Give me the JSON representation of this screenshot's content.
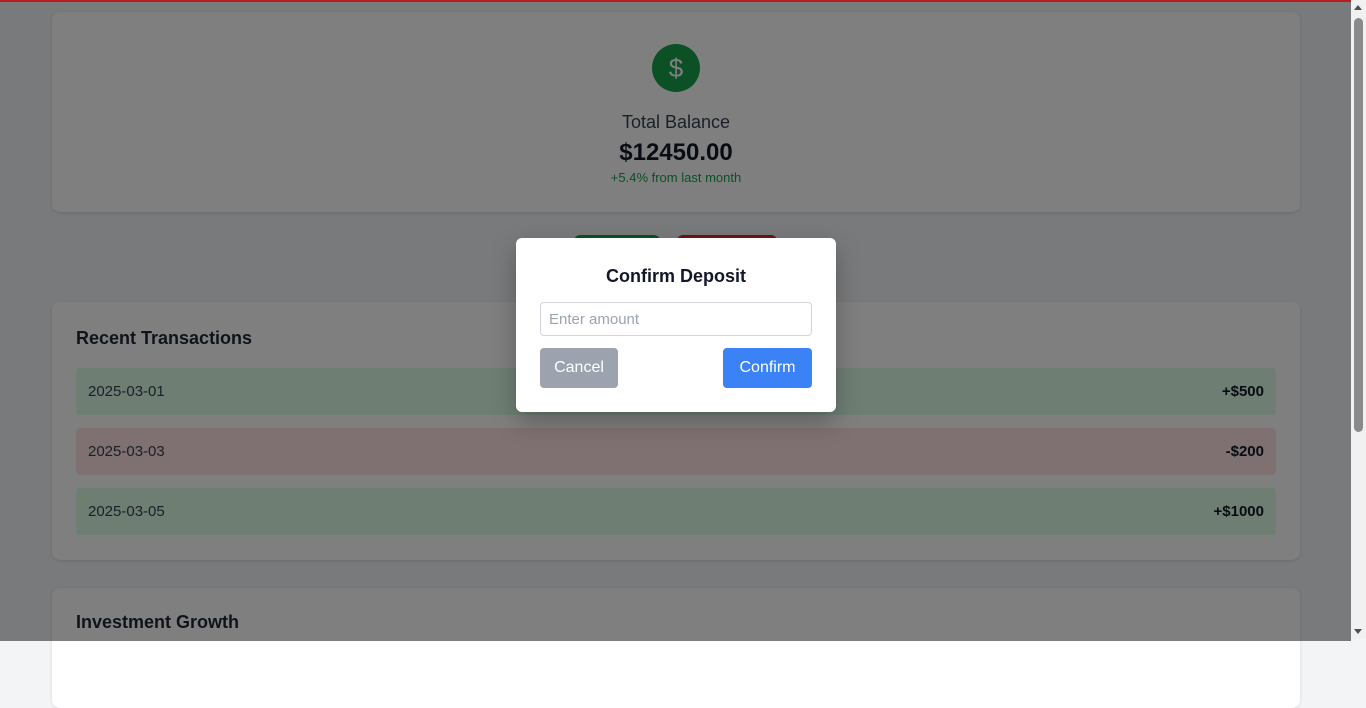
{
  "balance": {
    "icon": "dollar-sign-icon",
    "icon_glyph": "$",
    "label": "Total Balance",
    "amount": "$12450.00",
    "change": "+5.4% from last month"
  },
  "transactions": {
    "title": "Recent Transactions",
    "rows": [
      {
        "date": "2025-03-01",
        "amount": "+$500",
        "type": "credit"
      },
      {
        "date": "2025-03-03",
        "amount": "-$200",
        "type": "debit"
      },
      {
        "date": "2025-03-05",
        "amount": "+$1000",
        "type": "credit"
      }
    ]
  },
  "investment": {
    "title": "Investment Growth"
  },
  "modal": {
    "title": "Confirm Deposit",
    "amount_placeholder": "Enter amount",
    "amount_value": "",
    "cancel_label": "Cancel",
    "confirm_label": "Confirm"
  },
  "colors": {
    "accent_green": "#16a34a",
    "accent_red": "#dc2626",
    "confirm_blue": "#3b82f6",
    "cancel_gray": "#9ca3af"
  }
}
